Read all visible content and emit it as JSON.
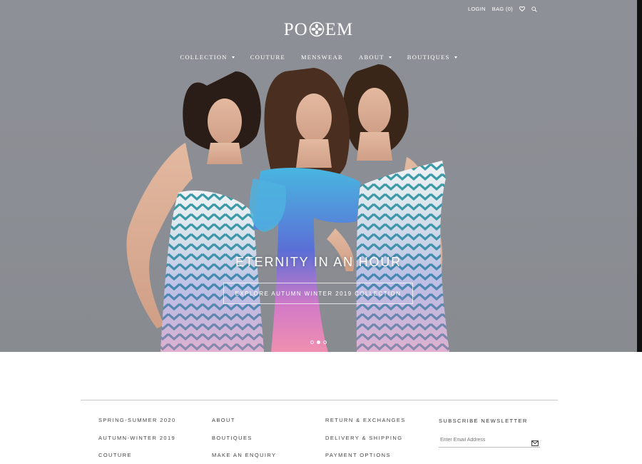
{
  "utility": {
    "login": "LOGIN",
    "bag": "BAG (0)"
  },
  "logo": {
    "left": "PO",
    "right": "EM"
  },
  "nav": [
    {
      "label": "COLLECTION",
      "dropdown": true
    },
    {
      "label": "COUTURE",
      "dropdown": false
    },
    {
      "label": "MENSWEAR",
      "dropdown": false
    },
    {
      "label": "ABOUT",
      "dropdown": true
    },
    {
      "label": "BOUTIQUES",
      "dropdown": true
    }
  ],
  "hero": {
    "title": "ETERNITY IN AN HOUR",
    "cta": "EXPLORE AUTUMN WINTER 2019 COLLECTION",
    "slides": 3,
    "active_slide": 2
  },
  "footer": {
    "col1": [
      "SPRING-SUMMER 2020",
      "AUTUMN-WINTER 2019",
      "COUTURE"
    ],
    "col2": [
      "ABOUT",
      "BOUTIQUES",
      "MAKE AN ENQUIRY"
    ],
    "col3": [
      "RETURN & EXCHANGES",
      "DELIVERY & SHIPPING",
      "PAYMENT OPTIONS"
    ],
    "newsletter": {
      "title": "SUBSCRIBE NEWSLETTER",
      "placeholder": "Enter Email Address"
    }
  },
  "colors": {
    "hero_bg": "#8b8e94",
    "text_light": "#ffffff",
    "footer_text": "#444444"
  },
  "icons": [
    "heart-icon",
    "search-icon",
    "flower-logo-icon",
    "mail-icon"
  ]
}
